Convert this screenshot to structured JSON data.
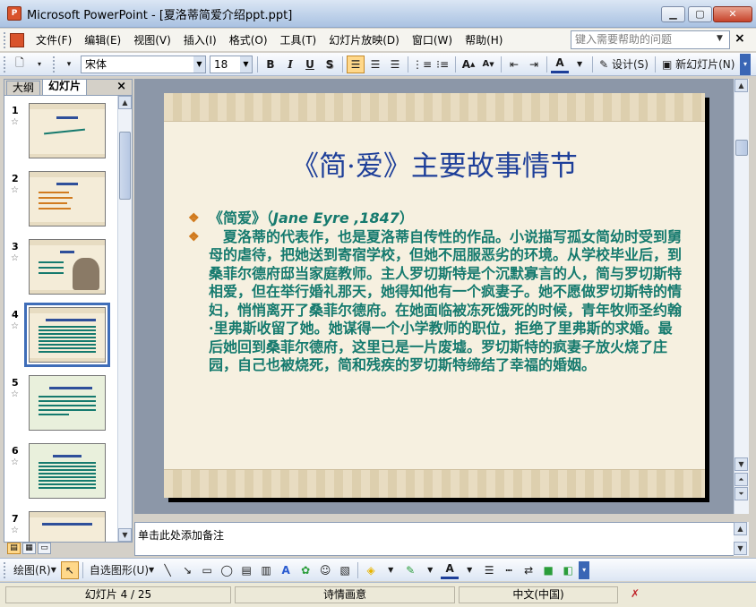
{
  "window": {
    "app_icon": "P",
    "title": "Microsoft PowerPoint - [夏洛蒂简爱介绍ppt.ppt]",
    "btn_min": "▁",
    "btn_max": "▢",
    "btn_close": "✕"
  },
  "menu": {
    "items": [
      "文件(F)",
      "编辑(E)",
      "视图(V)",
      "插入(I)",
      "格式(O)",
      "工具(T)",
      "幻灯片放映(D)",
      "窗口(W)",
      "帮助(H)"
    ],
    "help_placeholder": "键入需要帮助的问题",
    "close_doc": "×"
  },
  "toolbar": {
    "font": "宋体",
    "size": "18",
    "bold": "B",
    "italic": "I",
    "underline": "U",
    "shadow": "S",
    "design": "设计(S)",
    "new_slide": "新幻灯片(N)"
  },
  "pane": {
    "tab_outline": "大纲",
    "tab_slides": "幻灯片",
    "close": "×",
    "thumbs": [
      {
        "num": "1",
        "star": "☆"
      },
      {
        "num": "2",
        "star": "☆"
      },
      {
        "num": "3",
        "star": "☆"
      },
      {
        "num": "4",
        "star": "☆"
      },
      {
        "num": "5",
        "star": "☆"
      },
      {
        "num": "6",
        "star": "☆"
      },
      {
        "num": "7",
        "star": "☆"
      }
    ]
  },
  "slide": {
    "title": "《简·爱》主要故事情节",
    "bullet1_cn": "《简爱》（",
    "bullet1_en": "Jane Eyre ,1847",
    "bullet1_end": "）",
    "bullet2": "夏洛蒂的代表作，也是夏洛蒂自传性的作品。小说描写孤女简幼时受到舅母的虐待，把她送到寄宿学校，但她不屈服恶劣的环境。从学校毕业后，到桑菲尔德府邸当家庭教师。主人罗切斯特是个沉默寡言的人，简与罗切斯特相爱，但在举行婚礼那天，她得知他有一个疯妻子。她不愿做罗切斯特的情妇，悄悄离开了桑菲尔德府。在她面临被冻死饿死的时候，青年牧师圣约翰·里弗斯收留了她。她谋得一个小学教师的职位，拒绝了里弗斯的求婚。最后她回到桑菲尔德府，这里已是一片废墟。罗切斯特的疯妻子放火烧了庄园，自己也被烧死，简和残疾的罗切斯特缔结了幸福的婚姻。"
  },
  "notes": {
    "placeholder": "单击此处添加备注"
  },
  "drawing": {
    "draw": "绘图(R)",
    "autoshapes": "自选图形(U)"
  },
  "status": {
    "slide": "幻灯片 4 / 25",
    "design": "诗情画意",
    "lang": "中文(中国)"
  },
  "colors": {
    "title": "#1e3f99",
    "body": "#157a6e",
    "bullet": "#d17b1f",
    "selection": "#3f6db8"
  }
}
